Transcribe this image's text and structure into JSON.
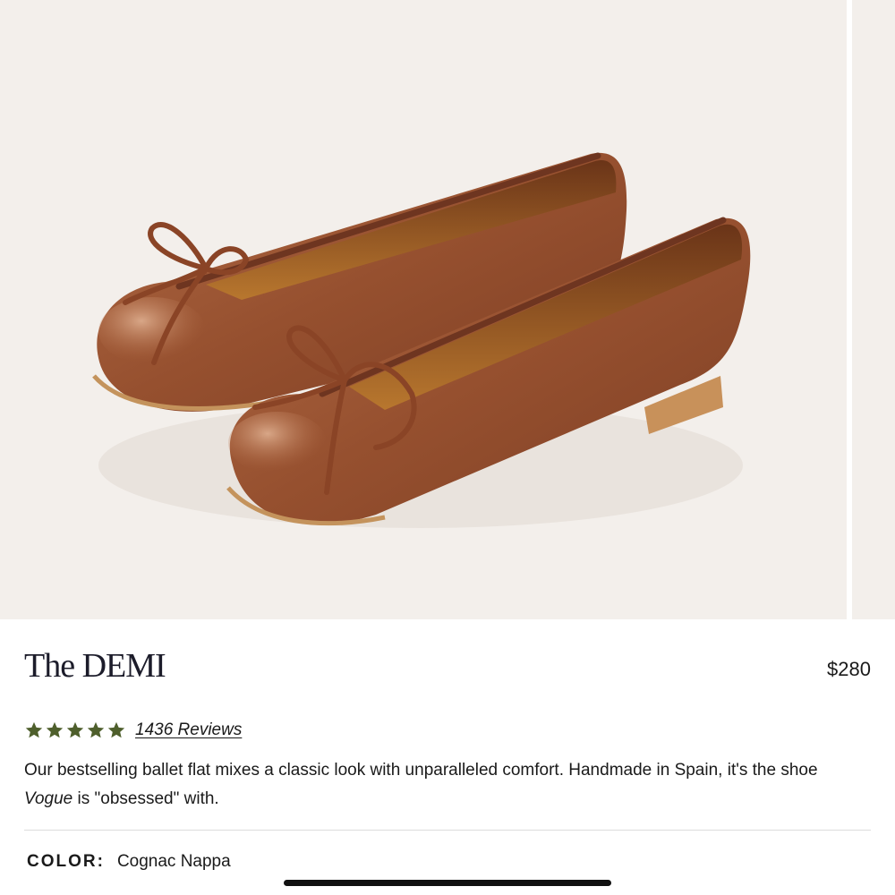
{
  "product": {
    "name": "The DEMI",
    "price": "$280",
    "image_alt": "Cognac leather ballet flats with bow"
  },
  "rating": {
    "stars": 5,
    "star_color": "#4e5f2c",
    "reviews_label": "1436 Reviews"
  },
  "description": {
    "text_part1": "Our bestselling ballet flat mixes a classic look with unparalleled comfort. Handmade in Spain, it's the shoe ",
    "emphasis": "Vogue",
    "text_part2": " is \"obsessed\" with."
  },
  "color": {
    "label": "COLOR:",
    "value": "Cognac Nappa",
    "swatch_hex": "#9c5634"
  }
}
